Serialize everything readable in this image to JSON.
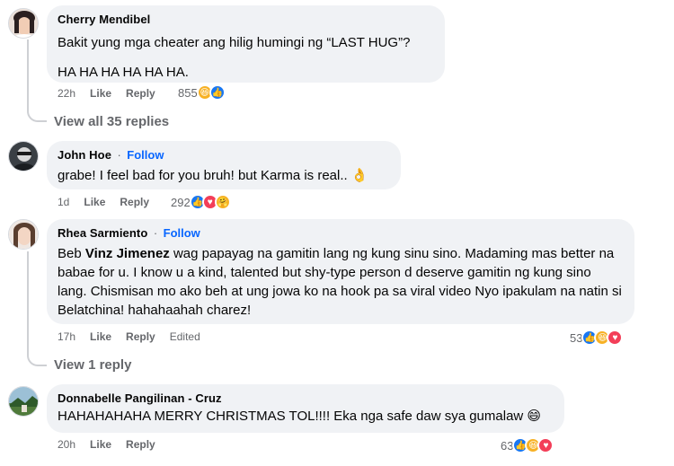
{
  "comments": [
    {
      "author": "Cherry Mendibel",
      "follow": "",
      "lines": [
        "Bakit yung mga cheater ang hilig humingi ng “LAST HUG”?",
        "HA HA HA HA HA HA."
      ],
      "time": "22h",
      "like": "Like",
      "reply": "Reply",
      "edited": "",
      "reactions_count": "855",
      "reactions": [
        "haha",
        "like"
      ],
      "view_replies": "View all 35 replies"
    },
    {
      "author": "John Hoe",
      "follow": "Follow",
      "lines": [
        "grabe! I feel bad for you bruh! but Karma is real.. 👌"
      ],
      "time": "1d",
      "like": "Like",
      "reply": "Reply",
      "edited": "",
      "reactions_count": "292",
      "reactions": [
        "like",
        "love",
        "care"
      ],
      "view_replies": ""
    },
    {
      "author": "Rhea Sarmiento",
      "follow": "Follow",
      "mention": "Vinz Jimenez",
      "text_prefix": "Beb ",
      "text_rest": " wag papayag na gamitin lang ng kung sinu sino. Madaming mas better na babae for u. I know u a kind, talented but shy-type person d deserve gamitin ng kung sino lang. Chismisan mo ako beh at ung jowa ko na hook pa sa viral video Nyo ipakulam na natin si Belatchina! hahahaahah charez!",
      "time": "17h",
      "like": "Like",
      "reply": "Reply",
      "edited": "Edited",
      "reactions_count": "53",
      "reactions": [
        "like",
        "haha",
        "love"
      ],
      "view_replies": "View 1 reply"
    },
    {
      "author": "Donnabelle Pangilinan - Cruz",
      "follow": "",
      "lines": [
        "HAHAHAHAHA MERRY CHRISTMAS TOL!!!! Eka nga safe daw sya gumalaw 😄"
      ],
      "time": "20h",
      "like": "Like",
      "reply": "Reply",
      "edited": "",
      "reactions_count": "63",
      "reactions": [
        "like",
        "haha",
        "love"
      ],
      "view_replies": ""
    }
  ],
  "separator": "·",
  "colors": {
    "bubble": "#f0f2f5",
    "link": "#0866ff",
    "meta": "#65676b",
    "text": "#050505"
  }
}
